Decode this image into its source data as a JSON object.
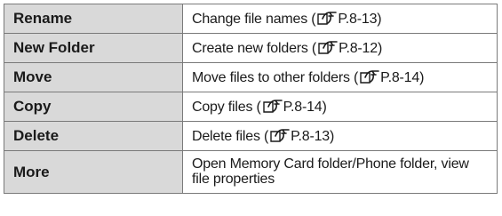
{
  "table": {
    "rows": [
      {
        "name": "Rename",
        "desc": "Change file names (",
        "ref": "P.8-13",
        "close": ")"
      },
      {
        "name": "New Folder",
        "desc": "Create new folders (",
        "ref": "P.8-12",
        "close": ")"
      },
      {
        "name": "Move",
        "desc": "Move files to other folders (",
        "ref": "P.8-14",
        "close": ")"
      },
      {
        "name": "Copy",
        "desc": "Copy files (",
        "ref": "P.8-14",
        "close": ")"
      },
      {
        "name": "Delete",
        "desc": "Delete files (",
        "ref": "P.8-13",
        "close": ")"
      },
      {
        "name": "More",
        "desc": "Open Memory Card folder/Phone folder, view file properties"
      }
    ],
    "icon": "page-reference-icon"
  }
}
